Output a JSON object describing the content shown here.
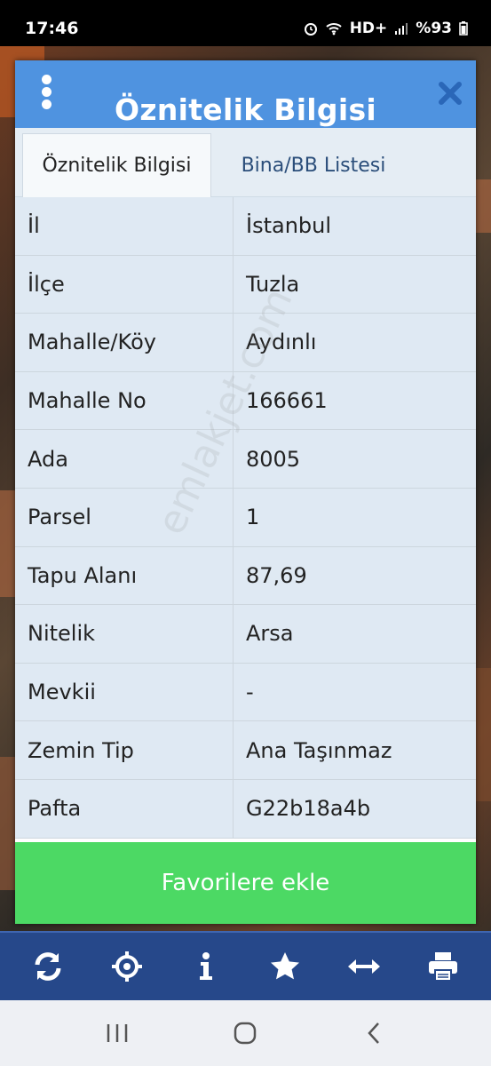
{
  "status_bar": {
    "time": "17:46",
    "battery": "%93",
    "network": "HD+"
  },
  "dialog": {
    "title": "Öznitelik Bilgisi",
    "tabs": [
      {
        "label": "Öznitelik Bilgisi",
        "active": true
      },
      {
        "label": "Bina/BB Listesi",
        "active": false
      }
    ],
    "rows": [
      {
        "label": "İl",
        "value": "İstanbul"
      },
      {
        "label": "İlçe",
        "value": "Tuzla"
      },
      {
        "label": "Mahalle/Köy",
        "value": "Aydınlı"
      },
      {
        "label": "Mahalle No",
        "value": "166661"
      },
      {
        "label": "Ada",
        "value": "8005"
      },
      {
        "label": "Parsel",
        "value": "1"
      },
      {
        "label": "Tapu Alanı",
        "value": "87,69"
      },
      {
        "label": "Nitelik",
        "value": "Arsa"
      },
      {
        "label": "Mevkii",
        "value": "-"
      },
      {
        "label": "Zemin Tip",
        "value": "Ana Taşınmaz"
      },
      {
        "label": "Pafta",
        "value": "G22b18a4b"
      }
    ],
    "favorite_button": "Favorilere ekle",
    "watermark": "emlakjet.com"
  },
  "toolbar": {
    "items": [
      "refresh-icon",
      "locate-icon",
      "info-icon",
      "star-icon",
      "measure-icon",
      "print-icon"
    ]
  },
  "colors": {
    "header": "#4f93e0",
    "favorite": "#4cd964",
    "toolbar": "#26488a"
  }
}
